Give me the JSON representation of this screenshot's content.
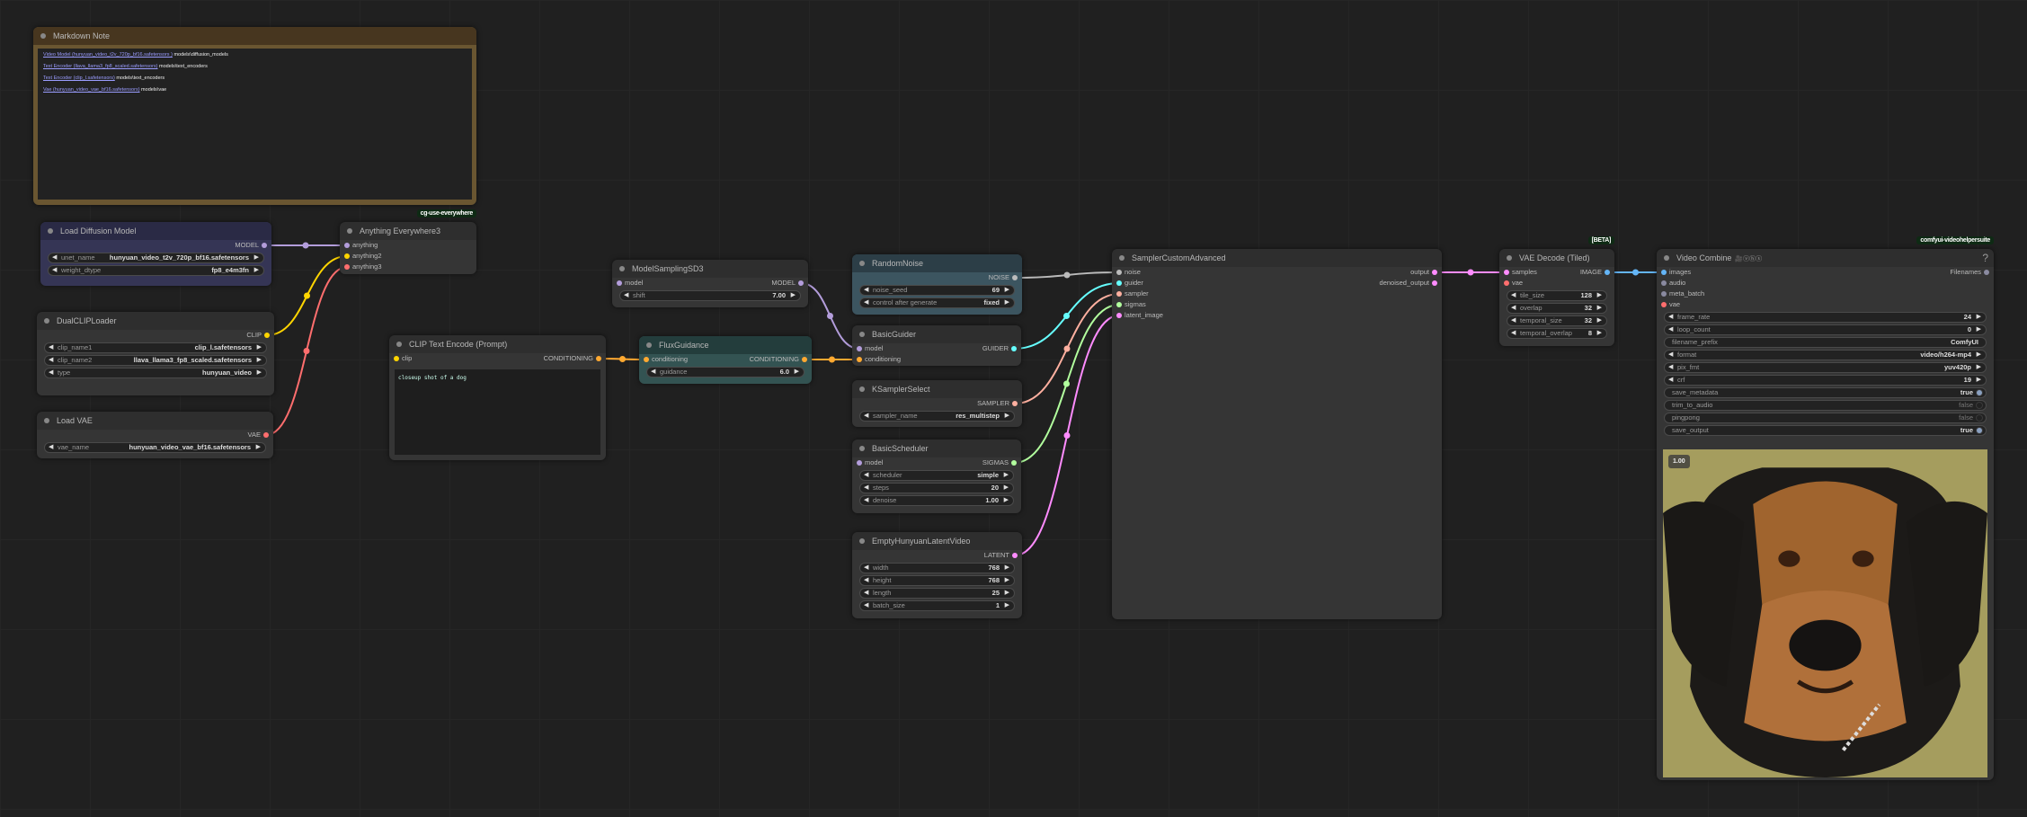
{
  "nodes": [
    {
      "title": "Markdown Note",
      "markdown": [
        {
          "link": "Video Model (hunyuan_video_t2v_720p_bf16.safetensors )",
          "path": " models\\diffusion_models"
        },
        {
          "link": "Text Encoder (llava_llama3_fp8_scaled.safetensors)",
          "path": " models\\text_encoders"
        },
        {
          "link": "Text Encoder (clip_l.safetensors)",
          "path": " models\\text_encoders"
        },
        {
          "link": "Vae (hunyuan_video_vae_bf16.safetensors)",
          "path": " models\\vae"
        }
      ]
    },
    {
      "title": "Load Diffusion Model",
      "inputs": [],
      "outputs": [
        {
          "label": "MODEL",
          "color": "#b39ddb"
        }
      ],
      "widgets": [
        {
          "label": "unet_name",
          "value": "hunyuan_video_t2v_720p_bf16.safetensors",
          "arrows": true
        },
        {
          "label": "weight_dtype",
          "value": "fp8_e4m3fn",
          "arrows": true
        }
      ]
    },
    {
      "title": "Anything Everywhere3",
      "badge": "cg-use-everywhere",
      "inputs": [
        {
          "label": "anything",
          "color": "#b39ddb"
        },
        {
          "label": "anything2",
          "color": "#ffd500"
        },
        {
          "label": "anything3",
          "color": "#ff6e6e"
        }
      ],
      "outputs": [],
      "widgets": []
    },
    {
      "title": "DualCLIPLoader",
      "inputs": [],
      "outputs": [
        {
          "label": "CLIP",
          "color": "#ffd500"
        }
      ],
      "widgets": [
        {
          "label": "clip_name1",
          "value": "clip_l.safetensors",
          "arrows": true
        },
        {
          "label": "clip_name2",
          "value": "llava_llama3_fp8_scaled.safetensors",
          "arrows": true
        },
        {
          "label": "type",
          "value": "hunyuan_video",
          "arrows": true
        }
      ]
    },
    {
      "title": "Load VAE",
      "inputs": [],
      "outputs": [
        {
          "label": "VAE",
          "color": "#ff6e6e"
        }
      ],
      "widgets": [
        {
          "label": "vae_name",
          "value": "hunyuan_video_vae_bf16.safetensors",
          "arrows": true
        }
      ]
    },
    {
      "title": "CLIP Text Encode (Prompt)",
      "inputs": [
        {
          "label": "clip",
          "color": "#ffd500"
        }
      ],
      "outputs": [
        {
          "label": "CONDITIONING",
          "color": "#ffa931"
        }
      ],
      "widgets": [],
      "text": "closeup shot of a dog"
    },
    {
      "title": "ModelSamplingSD3",
      "inputs": [
        {
          "label": "model",
          "color": "#b39ddb"
        }
      ],
      "outputs": [
        {
          "label": "MODEL",
          "color": "#b39ddb"
        }
      ],
      "widgets": [
        {
          "label": "shift",
          "value": "7.00",
          "arrows": true
        }
      ]
    },
    {
      "title": "FluxGuidance",
      "inputs": [
        {
          "label": "conditioning",
          "color": "#ffa931"
        }
      ],
      "outputs": [
        {
          "label": "CONDITIONING",
          "color": "#ffa931"
        }
      ],
      "widgets": [
        {
          "label": "guidance",
          "value": "6.0",
          "arrows": true
        }
      ]
    },
    {
      "title": "RandomNoise",
      "inputs": [],
      "outputs": [
        {
          "label": "NOISE",
          "color": "#bbbbbb"
        }
      ],
      "widgets": [
        {
          "label": "noise_seed",
          "value": "69",
          "arrows": true
        },
        {
          "label": "control after generate",
          "value": "fixed",
          "arrows": true
        }
      ]
    },
    {
      "title": "BasicGuider",
      "inputs": [
        {
          "label": "model",
          "color": "#b39ddb"
        },
        {
          "label": "conditioning",
          "color": "#ffa931"
        }
      ],
      "outputs": [
        {
          "label": "GUIDER",
          "color": "#66ffff"
        }
      ],
      "widgets": []
    },
    {
      "title": "KSamplerSelect",
      "inputs": [],
      "outputs": [
        {
          "label": "SAMPLER",
          "color": "#ffb0a0"
        }
      ],
      "widgets": [
        {
          "label": "sampler_name",
          "value": "res_multistep",
          "arrows": true
        }
      ]
    },
    {
      "title": "BasicScheduler",
      "inputs": [
        {
          "label": "model",
          "color": "#b39ddb"
        }
      ],
      "outputs": [
        {
          "label": "SIGMAS",
          "color": "#b2ff9e"
        }
      ],
      "widgets": [
        {
          "label": "scheduler",
          "value": "simple",
          "arrows": true
        },
        {
          "label": "steps",
          "value": "20",
          "arrows": true
        },
        {
          "label": "denoise",
          "value": "1.00",
          "arrows": true
        }
      ]
    },
    {
      "title": "EmptyHunyuanLatentVideo",
      "inputs": [],
      "outputs": [
        {
          "label": "LATENT",
          "color": "#ff8cff"
        }
      ],
      "widgets": [
        {
          "label": "width",
          "value": "768",
          "arrows": true
        },
        {
          "label": "height",
          "value": "768",
          "arrows": true
        },
        {
          "label": "length",
          "value": "25",
          "arrows": true
        },
        {
          "label": "batch_size",
          "value": "1",
          "arrows": true
        }
      ]
    },
    {
      "title": "SamplerCustomAdvanced",
      "inputs": [
        {
          "label": "noise",
          "color": "#bbbbbb"
        },
        {
          "label": "guider",
          "color": "#66ffff"
        },
        {
          "label": "sampler",
          "color": "#ffb0a0"
        },
        {
          "label": "sigmas",
          "color": "#b2ff9e"
        },
        {
          "label": "latent_image",
          "color": "#ff8cff"
        }
      ],
      "outputs": [
        {
          "label": "output",
          "color": "#ff8cff"
        },
        {
          "label": "denoised_output",
          "color": "#ff8cff"
        }
      ],
      "widgets": []
    },
    {
      "title": "VAE Decode (Tiled)",
      "badge": "[BETA]",
      "inputs": [
        {
          "label": "samples",
          "color": "#ff8cff"
        },
        {
          "label": "vae",
          "color": "#ff6e6e"
        }
      ],
      "outputs": [
        {
          "label": "IMAGE",
          "color": "#64b5f6"
        }
      ],
      "widgets": [
        {
          "label": "tile_size",
          "value": "128",
          "arrows": true
        },
        {
          "label": "overlap",
          "value": "32",
          "arrows": true
        },
        {
          "label": "temporal_size",
          "value": "32",
          "arrows": true
        },
        {
          "label": "temporal_overlap",
          "value": "8",
          "arrows": true
        }
      ]
    },
    {
      "title": "Video Combine",
      "badge": "comfyui-videohelpersuite",
      "title_icons": "🎥ⓥⓗⓢ",
      "help": "?",
      "inputs": [
        {
          "label": "images",
          "color": "#64b5f6"
        },
        {
          "label": "audio",
          "color": "#8a8aa0"
        },
        {
          "label": "meta_batch",
          "color": "#8a8aa0"
        },
        {
          "label": "vae",
          "color": "#ff6e6e"
        }
      ],
      "outputs": [
        {
          "label": "Filenames",
          "color": "#8a8aa0"
        }
      ],
      "widgets": [
        {
          "label": "frame_rate",
          "value": "24",
          "arrows": true
        },
        {
          "label": "loop_count",
          "value": "0",
          "arrows": true
        },
        {
          "label": "filename_prefix",
          "value": "ComfyUI",
          "arrows": false
        },
        {
          "label": "format",
          "value": "video/h264-mp4",
          "arrows": true
        },
        {
          "label": "pix_fmt",
          "value": "yuv420p",
          "arrows": true
        },
        {
          "label": "crf",
          "value": "19",
          "arrows": true
        },
        {
          "label": "save_metadata",
          "value": "true",
          "toggle": true,
          "on": true
        },
        {
          "label": "trim_to_audio",
          "value": "false",
          "toggle": true,
          "on": false
        },
        {
          "label": "pingpong",
          "value": "false",
          "toggle": true,
          "on": false
        },
        {
          "label": "save_output",
          "value": "true",
          "toggle": true,
          "on": true
        }
      ],
      "preview_label": "1.00"
    }
  ]
}
